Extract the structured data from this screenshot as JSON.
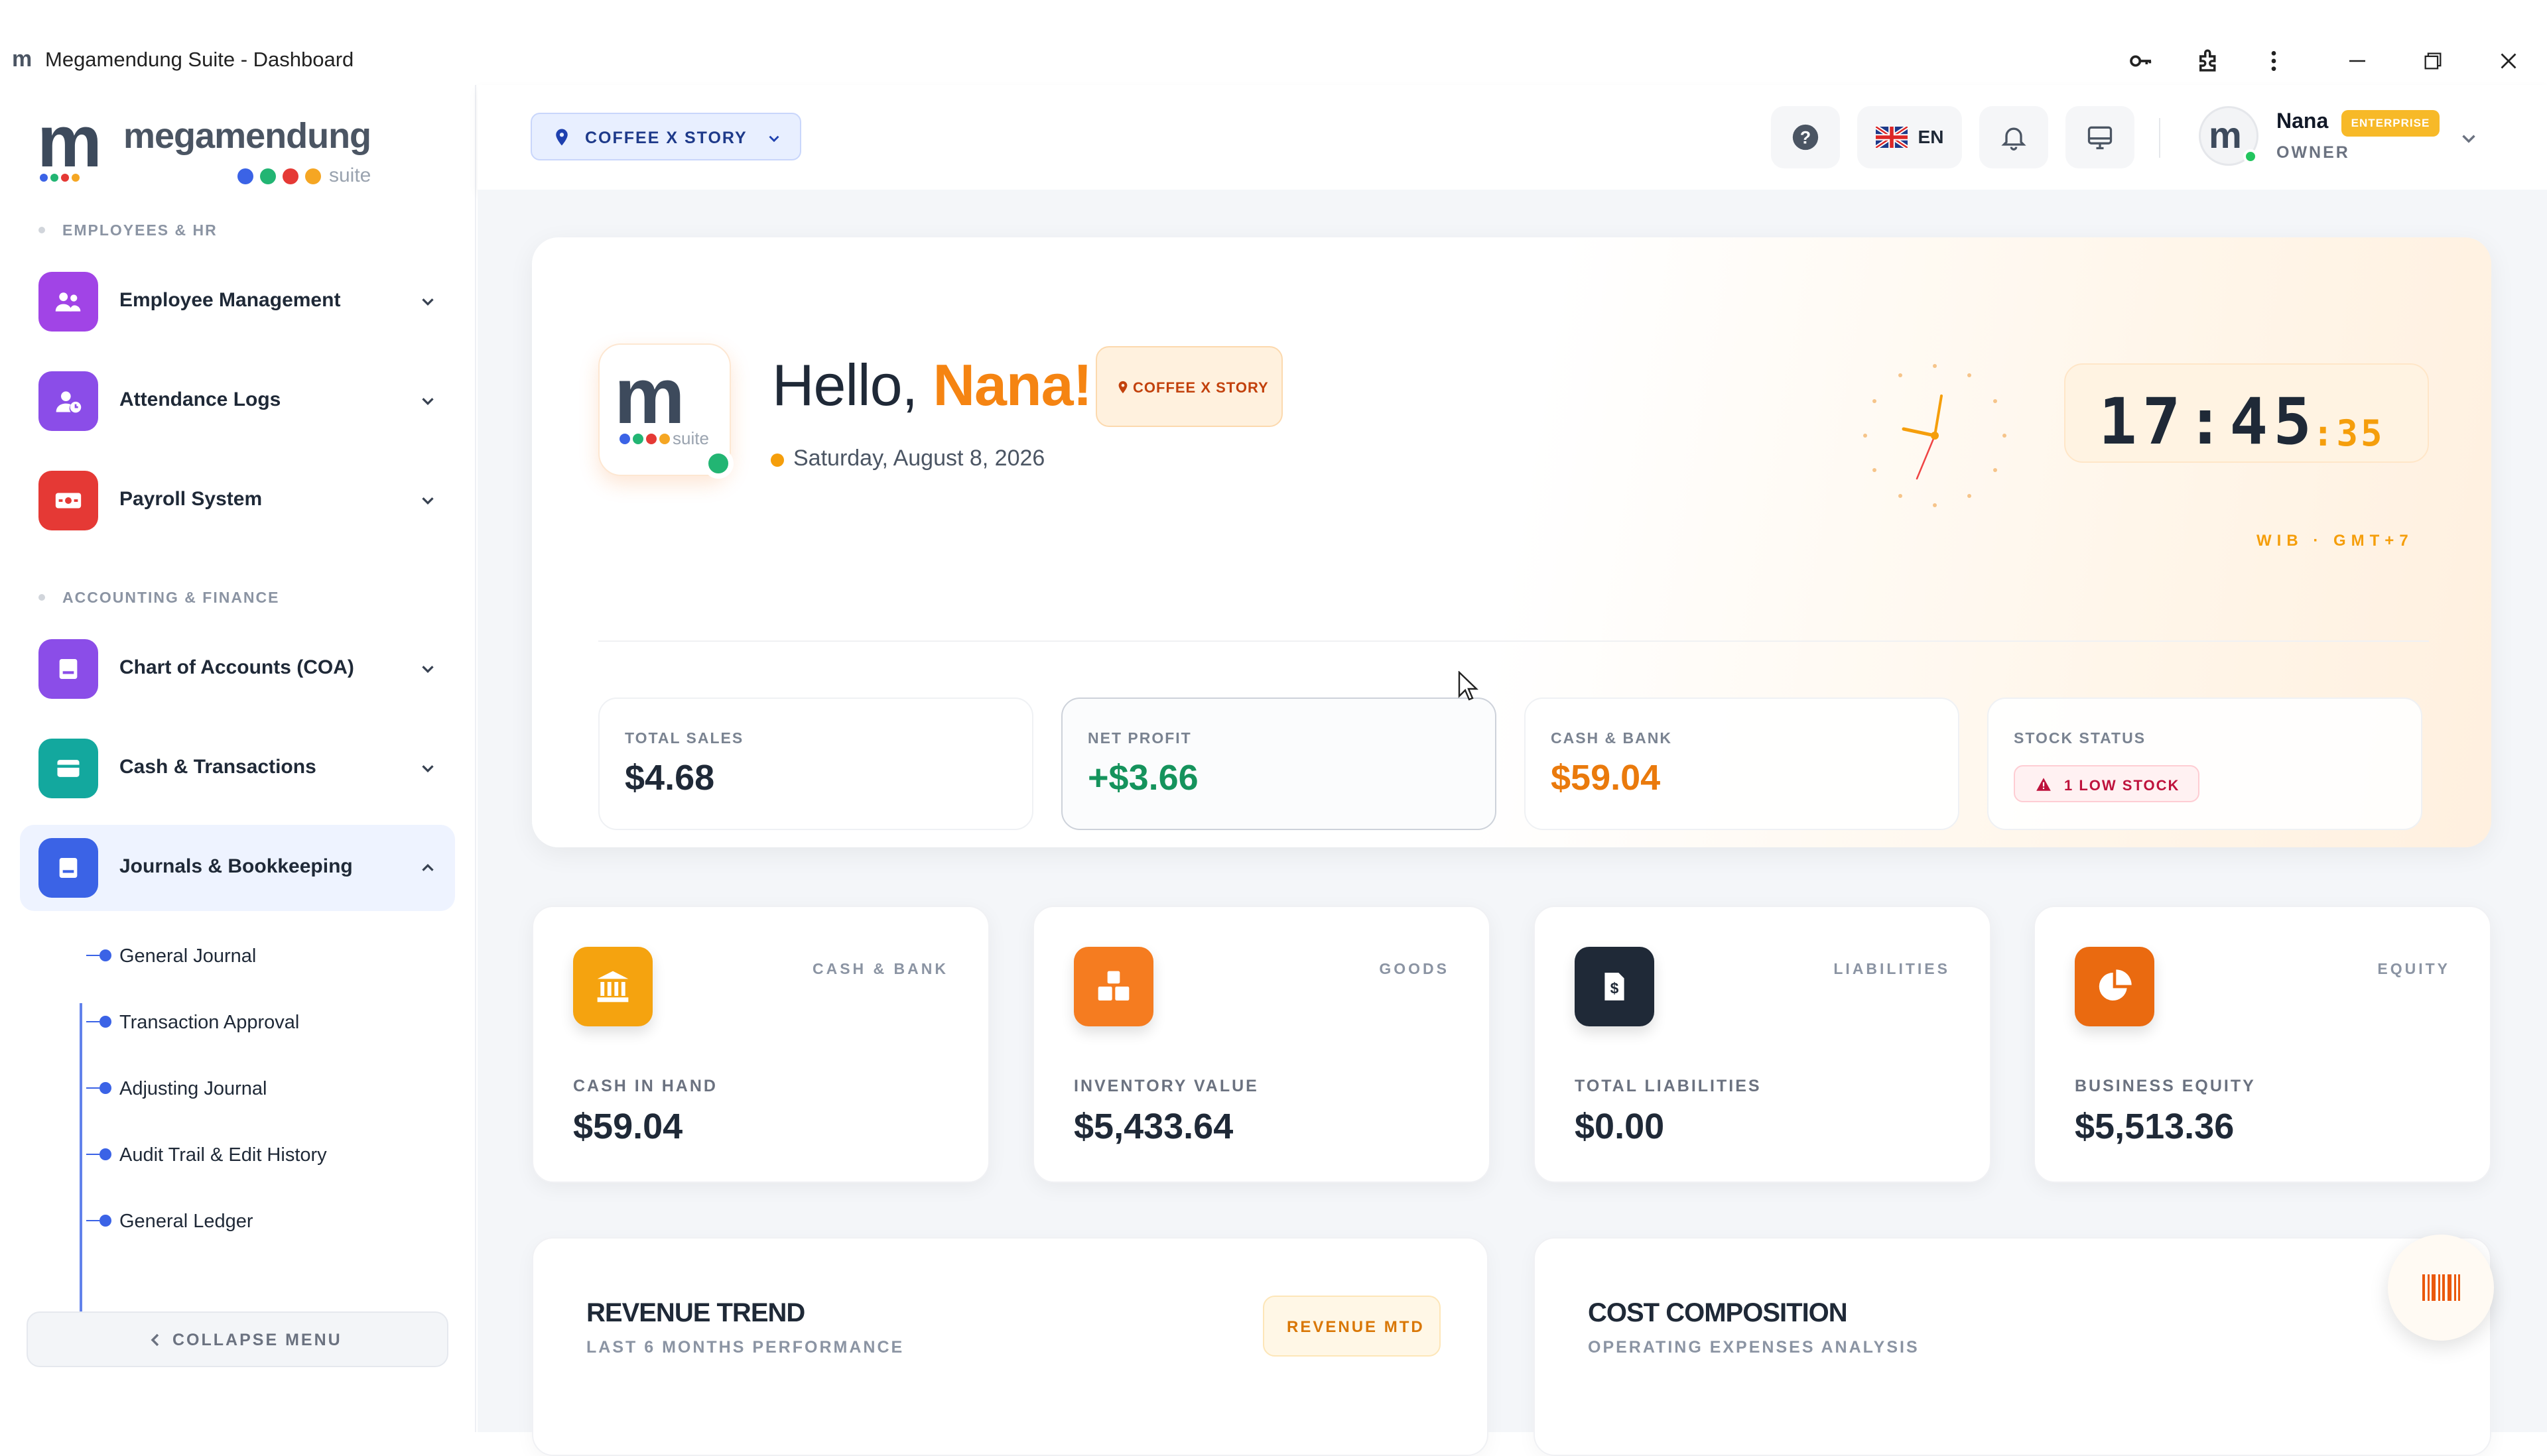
{
  "window": {
    "app_icon": "m",
    "title": "Megamendung Suite - Dashboard",
    "controls": [
      "key-icon",
      "extension-icon",
      "more-icon",
      "minimize-icon",
      "restore-icon",
      "close-icon"
    ]
  },
  "brand": {
    "mark": "m",
    "name": "megamendung",
    "suite": "suite",
    "dot_colors": [
      "#3b63e6",
      "#22b573",
      "#e53935",
      "#f5a623"
    ]
  },
  "sidebar": {
    "section_hr": "EMPLOYEES & HR",
    "section_finance": "ACCOUNTING & FINANCE",
    "items": [
      {
        "label": "Employee Management",
        "icon": "users-icon",
        "color": "#a144e6"
      },
      {
        "label": "Attendance Logs",
        "icon": "user-clock-icon",
        "color": "#8b4de8"
      },
      {
        "label": "Payroll System",
        "icon": "money-icon",
        "color": "#e53935"
      },
      {
        "label": "Chart of Accounts (COA)",
        "icon": "book-icon",
        "color": "#8b4de8"
      },
      {
        "label": "Cash & Transactions",
        "icon": "wallet-icon",
        "color": "#13a89e"
      },
      {
        "label": "Journals & Bookkeeping",
        "icon": "journal-icon",
        "color": "#3b63e6"
      }
    ],
    "sub_items": [
      "General Journal",
      "Transaction Approval",
      "Adjusting Journal",
      "Audit Trail & Edit History",
      "General Ledger"
    ],
    "collapse": "COLLAPSE MENU"
  },
  "topbar": {
    "location": "COFFEE X STORY",
    "lang": "EN",
    "user_name": "Nana",
    "user_badge": "ENTERPRISE",
    "user_role": "OWNER",
    "avatar": "m"
  },
  "hero": {
    "hello": "Hello,",
    "name": "Nana!",
    "store_badge": "COFFEE X STORY",
    "date": "Saturday, August 8, 2026",
    "time_hm": "17:45",
    "time_sec": ":35",
    "timezone": "WIB · GMT+7",
    "logo_mark": "m",
    "logo_suite": "suite"
  },
  "stats": [
    {
      "caption": "TOTAL SALES",
      "value": "$4.68",
      "color": "#1f2937"
    },
    {
      "caption": "NET PROFIT",
      "value": "+$3.66",
      "color": "#15935c"
    },
    {
      "caption": "CASH & BANK",
      "value": "$59.04",
      "color": "#ea7a0c"
    },
    {
      "caption": "STOCK STATUS",
      "badge": "1 LOW STOCK"
    }
  ],
  "kpis": [
    {
      "tag": "CASH & BANK",
      "caption": "CASH IN HAND",
      "value": "$59.04",
      "icon": "bank-icon",
      "color": "#f5a30f"
    },
    {
      "tag": "GOODS",
      "caption": "INVENTORY VALUE",
      "value": "$5,433.64",
      "icon": "boxes-icon",
      "color": "#f57c20"
    },
    {
      "tag": "LIABILITIES",
      "caption": "TOTAL LIABILITIES",
      "value": "$0.00",
      "icon": "invoice-icon",
      "color": "#1f2937"
    },
    {
      "tag": "EQUITY",
      "caption": "BUSINESS EQUITY",
      "value": "$5,513.36",
      "icon": "pie-chart-icon",
      "color": "#ea6a10"
    }
  ],
  "panels": {
    "revenue_title": "REVENUE TREND",
    "revenue_sub": "LAST 6 MONTHS PERFORMANCE",
    "revenue_badge": "REVENUE MTD",
    "cost_title": "COST COMPOSITION",
    "cost_sub": "OPERATING EXPENSES ANALYSIS"
  },
  "fab": {
    "icon": "barcode-icon"
  }
}
